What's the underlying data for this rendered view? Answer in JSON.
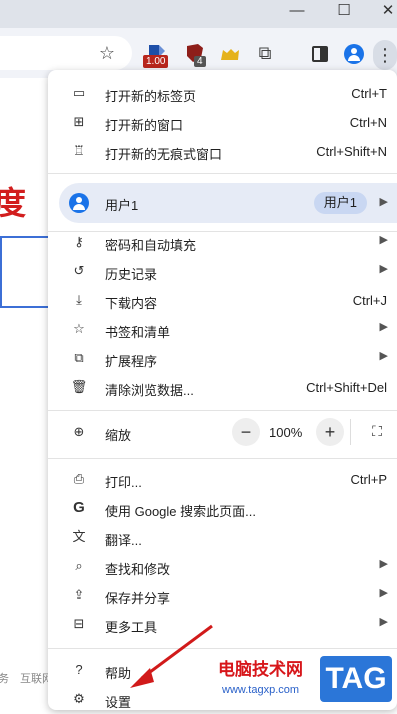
{
  "window": {
    "minimize": "—",
    "maximize": "☐",
    "close": "✕"
  },
  "toolbar": {
    "ext_badge_1": "1.00",
    "ext_badge_2": "4"
  },
  "page": {
    "partial_char": "度",
    "footer_left": "务",
    "footer_mid": "互联网"
  },
  "menu": {
    "items_top": [
      {
        "label": "打开新的标签页",
        "shortcut": "Ctrl+T",
        "icon": "new-tab-icon"
      },
      {
        "label": "打开新的窗口",
        "shortcut": "Ctrl+N",
        "icon": "new-window-icon"
      },
      {
        "label": "打开新的无痕式窗口",
        "shortcut": "Ctrl+Shift+N",
        "icon": "incognito-icon"
      }
    ],
    "profile": {
      "label": "用户1",
      "badge": "用户1"
    },
    "items_mid": [
      {
        "label": "密码和自动填充",
        "icon": "key-icon",
        "submenu": true
      },
      {
        "label": "历史记录",
        "icon": "history-icon",
        "submenu": true
      },
      {
        "label": "下载内容",
        "shortcut": "Ctrl+J",
        "icon": "download-icon"
      },
      {
        "label": "书签和清单",
        "icon": "star-icon",
        "submenu": true
      },
      {
        "label": "扩展程序",
        "icon": "puzzle-icon",
        "submenu": true
      },
      {
        "label": "清除浏览数据...",
        "shortcut": "Ctrl+Shift+Del",
        "icon": "trash-icon"
      }
    ],
    "zoom": {
      "label": "缩放",
      "value": "100%",
      "minus": "−",
      "plus": "+"
    },
    "items_bottom": [
      {
        "label": "打印...",
        "shortcut": "Ctrl+P",
        "icon": "print-icon"
      },
      {
        "label": "使用 Google 搜索此页面...",
        "icon": "google-icon"
      },
      {
        "label": "翻译...",
        "icon": "translate-icon"
      },
      {
        "label": "查找和修改",
        "icon": "find-icon",
        "submenu": true
      },
      {
        "label": "保存并分享",
        "icon": "share-icon",
        "submenu": true
      },
      {
        "label": "更多工具",
        "icon": "toolbox-icon",
        "submenu": true
      }
    ],
    "help": "帮助",
    "settings": "设置"
  },
  "watermark": {
    "site_name": "电脑技术网",
    "url": "www.tagxp.com",
    "logo": "TAG"
  },
  "colors": {
    "accent": "#1a73e8",
    "arrow": "#d11a1a"
  }
}
